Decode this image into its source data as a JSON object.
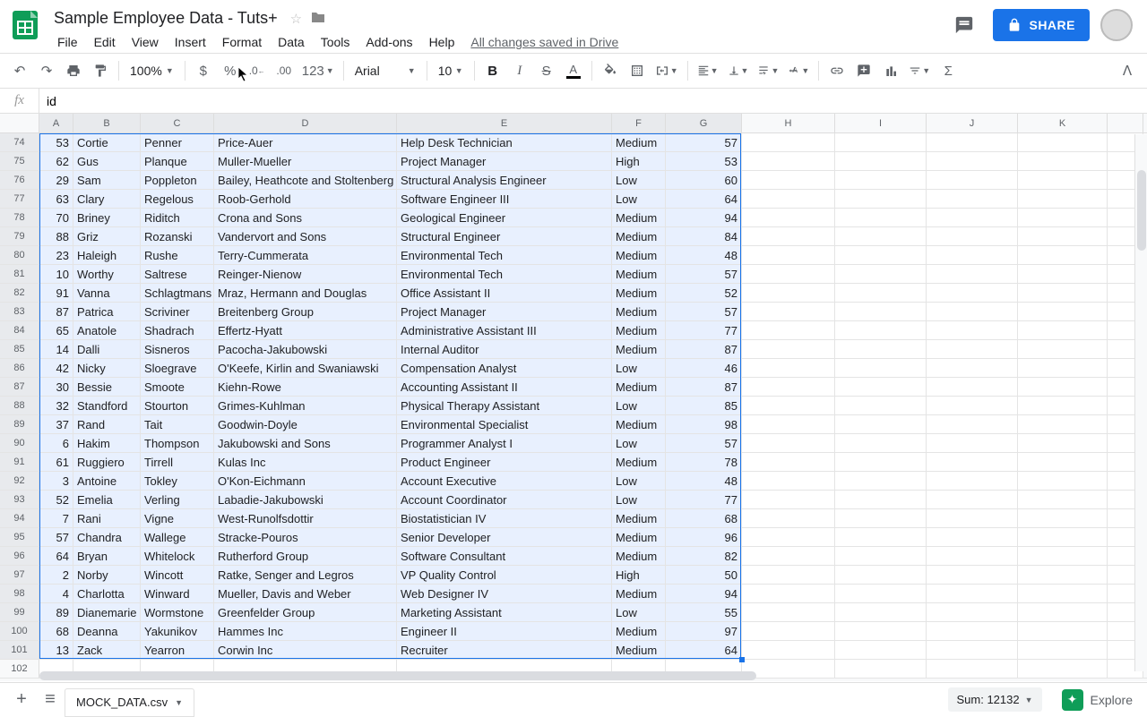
{
  "doc": {
    "title": "Sample Employee Data - Tuts+",
    "save_msg": "All changes saved in Drive"
  },
  "menus": [
    "File",
    "Edit",
    "View",
    "Insert",
    "Format",
    "Data",
    "Tools",
    "Add-ons",
    "Help"
  ],
  "share_label": "SHARE",
  "toolbar": {
    "zoom": "100%",
    "font": "Arial",
    "size": "10",
    "more_formats": "123"
  },
  "fx": {
    "value": "id"
  },
  "columns": [
    "A",
    "B",
    "C",
    "D",
    "E",
    "F",
    "G",
    "H",
    "I",
    "J",
    "K"
  ],
  "col_widths": [
    "c-A",
    "c-B",
    "c-C",
    "c-D",
    "c-E",
    "c-F",
    "c-G",
    "c-H",
    "c-I",
    "c-J",
    "c-K"
  ],
  "selected_cols": [
    "A",
    "B",
    "C",
    "D",
    "E",
    "F",
    "G"
  ],
  "visible_row_start": 74,
  "rows": [
    {
      "A": "53",
      "B": "Cortie",
      "C": "Penner",
      "D": "Price-Auer",
      "E": "Help Desk Technician",
      "F": "Medium",
      "G": "57"
    },
    {
      "A": "62",
      "B": "Gus",
      "C": "Planque",
      "D": "Muller-Mueller",
      "E": "Project Manager",
      "F": "High",
      "G": "53"
    },
    {
      "A": "29",
      "B": "Sam",
      "C": "Poppleton",
      "D": "Bailey, Heathcote and Stoltenberg",
      "E": "Structural Analysis Engineer",
      "F": "Low",
      "G": "60"
    },
    {
      "A": "63",
      "B": "Clary",
      "C": "Regelous",
      "D": "Roob-Gerhold",
      "E": "Software Engineer III",
      "F": "Low",
      "G": "64"
    },
    {
      "A": "70",
      "B": "Briney",
      "C": "Riditch",
      "D": "Crona and Sons",
      "E": "Geological Engineer",
      "F": "Medium",
      "G": "94"
    },
    {
      "A": "88",
      "B": "Griz",
      "C": "Rozanski",
      "D": "Vandervort and Sons",
      "E": "Structural Engineer",
      "F": "Medium",
      "G": "84"
    },
    {
      "A": "23",
      "B": "Haleigh",
      "C": "Rushe",
      "D": "Terry-Cummerata",
      "E": "Environmental Tech",
      "F": "Medium",
      "G": "48"
    },
    {
      "A": "10",
      "B": "Worthy",
      "C": "Saltrese",
      "D": "Reinger-Nienow",
      "E": "Environmental Tech",
      "F": "Medium",
      "G": "57"
    },
    {
      "A": "91",
      "B": "Vanna",
      "C": "Schlagtmans",
      "D": "Mraz, Hermann and Douglas",
      "E": "Office Assistant II",
      "F": "Medium",
      "G": "52"
    },
    {
      "A": "87",
      "B": "Patrica",
      "C": "Scriviner",
      "D": "Breitenberg Group",
      "E": "Project Manager",
      "F": "Medium",
      "G": "57"
    },
    {
      "A": "65",
      "B": "Anatole",
      "C": "Shadrach",
      "D": "Effertz-Hyatt",
      "E": "Administrative Assistant III",
      "F": "Medium",
      "G": "77"
    },
    {
      "A": "14",
      "B": "Dalli",
      "C": "Sisneros",
      "D": "Pacocha-Jakubowski",
      "E": "Internal Auditor",
      "F": "Medium",
      "G": "87"
    },
    {
      "A": "42",
      "B": "Nicky",
      "C": "Sloegrave",
      "D": "O'Keefe, Kirlin and Swaniawski",
      "E": "Compensation Analyst",
      "F": "Low",
      "G": "46"
    },
    {
      "A": "30",
      "B": "Bessie",
      "C": "Smoote",
      "D": "Kiehn-Rowe",
      "E": "Accounting Assistant II",
      "F": "Medium",
      "G": "87"
    },
    {
      "A": "32",
      "B": "Standford",
      "C": "Stourton",
      "D": "Grimes-Kuhlman",
      "E": "Physical Therapy Assistant",
      "F": "Low",
      "G": "85"
    },
    {
      "A": "37",
      "B": "Rand",
      "C": "Tait",
      "D": "Goodwin-Doyle",
      "E": "Environmental Specialist",
      "F": "Medium",
      "G": "98"
    },
    {
      "A": "6",
      "B": "Hakim",
      "C": "Thompson",
      "D": "Jakubowski and Sons",
      "E": "Programmer Analyst I",
      "F": "Low",
      "G": "57"
    },
    {
      "A": "61",
      "B": "Ruggiero",
      "C": "Tirrell",
      "D": "Kulas Inc",
      "E": "Product Engineer",
      "F": "Medium",
      "G": "78"
    },
    {
      "A": "3",
      "B": "Antoine",
      "C": "Tokley",
      "D": "O'Kon-Eichmann",
      "E": "Account Executive",
      "F": "Low",
      "G": "48"
    },
    {
      "A": "52",
      "B": "Emelia",
      "C": "Verling",
      "D": "Labadie-Jakubowski",
      "E": "Account Coordinator",
      "F": "Low",
      "G": "77"
    },
    {
      "A": "7",
      "B": "Rani",
      "C": "Vigne",
      "D": "West-Runolfsdottir",
      "E": "Biostatistician IV",
      "F": "Medium",
      "G": "68"
    },
    {
      "A": "57",
      "B": "Chandra",
      "C": "Wallege",
      "D": "Stracke-Pouros",
      "E": "Senior Developer",
      "F": "Medium",
      "G": "96"
    },
    {
      "A": "64",
      "B": "Bryan",
      "C": "Whitelock",
      "D": "Rutherford Group",
      "E": "Software Consultant",
      "F": "Medium",
      "G": "82"
    },
    {
      "A": "2",
      "B": "Norby",
      "C": "Wincott",
      "D": "Ratke, Senger and Legros",
      "E": "VP Quality Control",
      "F": "High",
      "G": "50"
    },
    {
      "A": "4",
      "B": "Charlotta",
      "C": "Winward",
      "D": "Mueller, Davis and Weber",
      "E": "Web Designer IV",
      "F": "Medium",
      "G": "94"
    },
    {
      "A": "89",
      "B": "Dianemarie",
      "C": "Wormstone",
      "D": "Greenfelder Group",
      "E": "Marketing Assistant",
      "F": "Low",
      "G": "55"
    },
    {
      "A": "68",
      "B": "Deanna",
      "C": "Yakunikov",
      "D": "Hammes Inc",
      "E": "Engineer II",
      "F": "Medium",
      "G": "97"
    },
    {
      "A": "13",
      "B": "Zack",
      "C": "Yearron",
      "D": "Corwin Inc",
      "E": "Recruiter",
      "F": "Medium",
      "G": "64"
    }
  ],
  "empty_rows": [
    102
  ],
  "bottom": {
    "sheet_tab": "MOCK_DATA.csv",
    "sum": "Sum: 12132",
    "explore": "Explore"
  }
}
